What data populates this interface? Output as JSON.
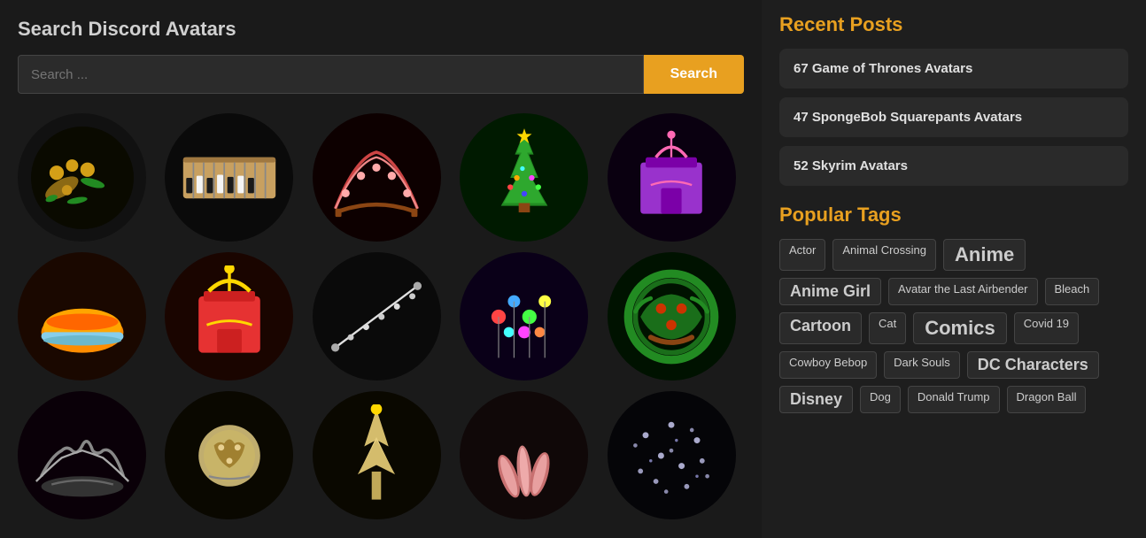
{
  "main": {
    "title": "Search Discord Avatars",
    "search": {
      "placeholder": "Search ...",
      "button_label": "Search"
    }
  },
  "sidebar": {
    "recent_posts_title": "Recent Posts",
    "recent_posts": [
      {
        "label": "67 Game of Thrones Avatars"
      },
      {
        "label": "47 SpongeBob Squarepants Avatars"
      },
      {
        "label": "52 Skyrim Avatars"
      }
    ],
    "popular_tags_title": "Popular Tags",
    "tags": [
      {
        "label": "Actor",
        "size": "small"
      },
      {
        "label": "Animal Crossing",
        "size": "small"
      },
      {
        "label": "Anime",
        "size": "large"
      },
      {
        "label": "Anime Girl",
        "size": "medium"
      },
      {
        "label": "Avatar the Last Airbender",
        "size": "small"
      },
      {
        "label": "Bleach",
        "size": "small"
      },
      {
        "label": "Cartoon",
        "size": "medium"
      },
      {
        "label": "Cat",
        "size": "small"
      },
      {
        "label": "Comics",
        "size": "large"
      },
      {
        "label": "Covid 19",
        "size": "small"
      },
      {
        "label": "Cowboy Bebop",
        "size": "small"
      },
      {
        "label": "Dark Souls",
        "size": "small"
      },
      {
        "label": "DC Characters",
        "size": "medium"
      },
      {
        "label": "Disney",
        "size": "medium"
      },
      {
        "label": "Dog",
        "size": "small"
      },
      {
        "label": "Donald Trump",
        "size": "small"
      },
      {
        "label": "Dragon Ball",
        "size": "small"
      }
    ]
  },
  "avatars": [
    {
      "id": 1,
      "color": "#1a1a00",
      "type": "floral"
    },
    {
      "id": 2,
      "color": "#0a0a0a",
      "type": "keyboard"
    },
    {
      "id": 3,
      "color": "#0d0000",
      "type": "wreath-pink"
    },
    {
      "id": 4,
      "color": "#001a00",
      "type": "xmas-tree"
    },
    {
      "id": 5,
      "color": "#0a0010",
      "type": "gift-purple"
    },
    {
      "id": 6,
      "color": "#1a0800",
      "type": "cake"
    },
    {
      "id": 7,
      "color": "#1a0800",
      "type": "gift-red"
    },
    {
      "id": 8,
      "color": "#0a0a0a",
      "type": "sparkle-line"
    },
    {
      "id": 9,
      "color": "#0a0018",
      "type": "lights"
    },
    {
      "id": 10,
      "color": "#001200",
      "type": "wreath-red"
    },
    {
      "id": 11,
      "color": "#0a0008",
      "type": "wreath-dark"
    },
    {
      "id": 12,
      "color": "#0a0800",
      "type": "ornament"
    },
    {
      "id": 13,
      "color": "#0a0800",
      "type": "star-topper"
    },
    {
      "id": 14,
      "color": "#100808",
      "type": "feathers"
    },
    {
      "id": 15,
      "color": "#050508",
      "type": "dark-sparkle"
    }
  ]
}
